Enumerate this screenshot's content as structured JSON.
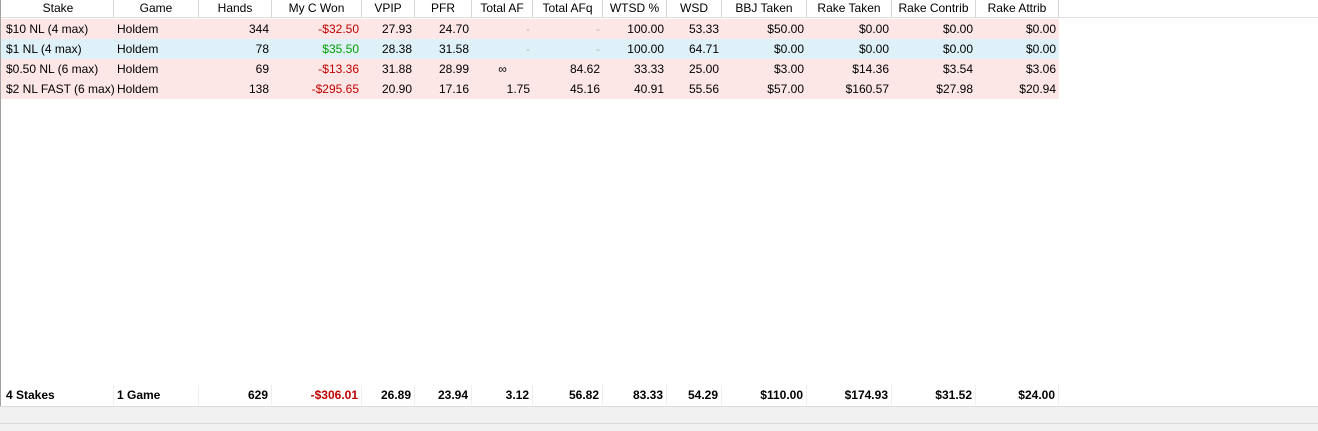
{
  "columns": [
    "Stake",
    "Game",
    "Hands",
    "My C Won",
    "VPIP",
    "PFR",
    "Total AF",
    "Total AFq",
    "WTSD %",
    "WSD",
    "BBJ Taken",
    "Rake Taken",
    "Rake Contrib",
    "Rake Attrib"
  ],
  "rows": [
    {
      "bg": "#fde6e6",
      "won_color": "neg",
      "cells": [
        "$10 NL (4 max)",
        "Holdem",
        "344",
        "-$32.50",
        "27.93",
        "24.70",
        "-",
        "-",
        "100.00",
        "53.33",
        "$50.00",
        "$0.00",
        "$0.00",
        "$0.00"
      ]
    },
    {
      "bg": "#def0f8",
      "won_color": "pos",
      "cells": [
        "$1 NL (4 max)",
        "Holdem",
        "78",
        "$35.50",
        "28.38",
        "31.58",
        "-",
        "-",
        "100.00",
        "64.71",
        "$0.00",
        "$0.00",
        "$0.00",
        "$0.00"
      ]
    },
    {
      "bg": "#fde6e6",
      "won_color": "neg",
      "cells": [
        "$0.50 NL (6 max)",
        "Holdem",
        "69",
        "-$13.36",
        "31.88",
        "28.99",
        "∞",
        "84.62",
        "33.33",
        "25.00",
        "$3.00",
        "$14.36",
        "$3.54",
        "$3.06"
      ]
    },
    {
      "bg": "#fde6e6",
      "won_color": "neg",
      "cells": [
        "$2 NL FAST (6 max)",
        "Holdem",
        "138",
        "-$295.65",
        "20.90",
        "17.16",
        "1.75",
        "45.16",
        "40.91",
        "55.56",
        "$57.00",
        "$160.57",
        "$27.98",
        "$20.94"
      ]
    }
  ],
  "totals": [
    "4 Stakes",
    "1 Game",
    "629",
    "-$306.01",
    "26.89",
    "23.94",
    "3.12",
    "56.82",
    "83.33",
    "54.29",
    "$110.00",
    "$174.93",
    "$31.52",
    "$24.00"
  ]
}
